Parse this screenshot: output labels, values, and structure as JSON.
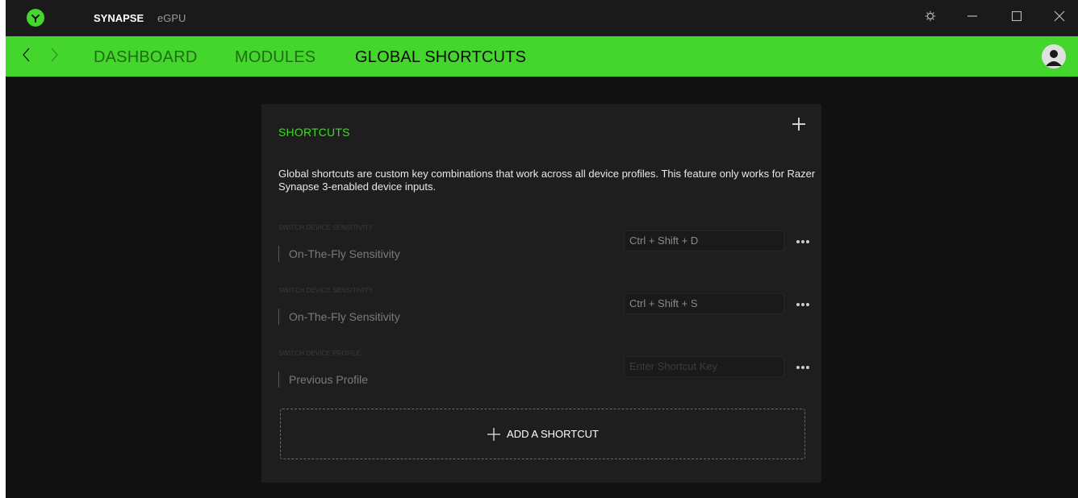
{
  "titlebar": {
    "tabs": [
      "SYNAPSE",
      "eGPU"
    ],
    "logo_icon": "razer-logo-icon",
    "controls": [
      "gear-icon",
      "minimize-icon",
      "maximize-icon",
      "close-icon"
    ]
  },
  "navbar": {
    "items": [
      "DASHBOARD",
      "MODULES",
      "GLOBAL SHORTCUTS"
    ],
    "active": "GLOBAL SHORTCUTS",
    "color": "#44d62c"
  },
  "panel": {
    "title": "SHORTCUTS",
    "description": "Global shortcuts are custom key combinations that work across all device profiles. This feature only works for Razer Synapse 3-enabled device inputs.",
    "shortcuts": [
      {
        "category": "SWITCH DEVICE SENSITIVITY",
        "name": "On-The-Fly Sensitivity",
        "key": "Ctrl + Shift + D",
        "placeholder": ""
      },
      {
        "category": "SWITCH DEVICE SENSITIVITY",
        "name": "On-The-Fly Sensitivity",
        "key": "Ctrl + Shift + S",
        "placeholder": ""
      },
      {
        "category": "SWITCH DEVICE PROFILE",
        "name": "Previous Profile",
        "key": "",
        "placeholder": "Enter Shortcut Key"
      }
    ],
    "add_label": "ADD A SHORTCUT"
  },
  "colors": {
    "accent": "#44d62c",
    "background": "#111111",
    "panel": "#1e1e1e"
  }
}
